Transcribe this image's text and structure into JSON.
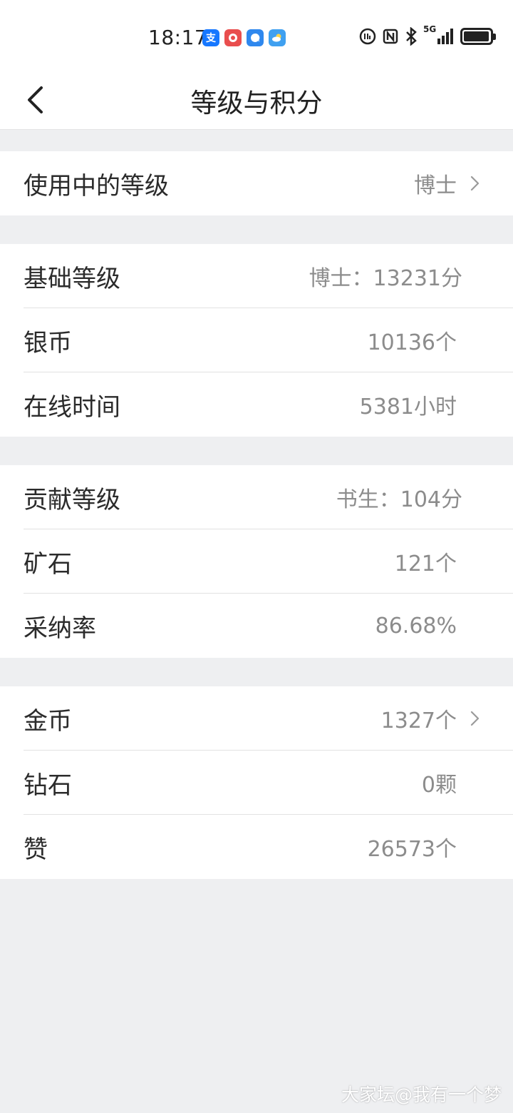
{
  "status_bar": {
    "time": "18:17",
    "app_icons": [
      {
        "name": "alipay-icon",
        "glyph": "支",
        "color": "#1677ff"
      },
      {
        "name": "game-app-icon",
        "glyph": "",
        "color": "#e94e4e"
      },
      {
        "name": "chat-app-icon",
        "glyph": "",
        "color": "#2f88ee"
      },
      {
        "name": "weather-app-icon",
        "glyph": "",
        "color": "#3fa0f0"
      }
    ],
    "network": "5G"
  },
  "header": {
    "title": "等级与积分"
  },
  "sections": [
    {
      "rows": [
        {
          "label": "使用中的等级",
          "value": "博士",
          "has_arrow": true
        }
      ]
    },
    {
      "rows": [
        {
          "label": "基础等级",
          "value": "博士：13231分",
          "has_arrow": false
        },
        {
          "label": "银币",
          "value": "10136个",
          "has_arrow": false
        },
        {
          "label": "在线时间",
          "value": "5381小时",
          "has_arrow": false
        }
      ]
    },
    {
      "rows": [
        {
          "label": "贡献等级",
          "value": "书生：104分",
          "has_arrow": false
        },
        {
          "label": "矿石",
          "value": "121个",
          "has_arrow": false
        },
        {
          "label": "采纳率",
          "value": "86.68%",
          "has_arrow": false
        }
      ]
    },
    {
      "rows": [
        {
          "label": "金币",
          "value": "1327个",
          "has_arrow": true
        },
        {
          "label": "钻石",
          "value": "0颗",
          "has_arrow": false
        },
        {
          "label": "赞",
          "value": "26573个",
          "has_arrow": false
        }
      ]
    }
  ],
  "watermark": "大家坛@我有一个梦",
  "colors": {
    "background": "#eeeff1",
    "card": "#ffffff",
    "label_text": "#2b2b2b",
    "value_text": "#8c8c8c"
  }
}
